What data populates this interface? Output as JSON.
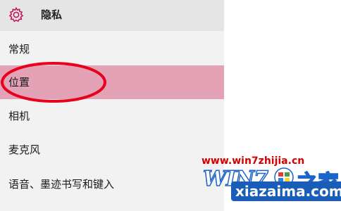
{
  "header": {
    "title": "隐私",
    "icon": "gear-icon"
  },
  "nav": {
    "items": [
      {
        "label": "常规",
        "selected": false
      },
      {
        "label": "位置",
        "selected": true
      },
      {
        "label": "相机",
        "selected": false
      },
      {
        "label": "麦克风",
        "selected": false
      },
      {
        "label": "语音、墨迹书写和键入",
        "selected": false
      }
    ]
  },
  "watermark": {
    "url": "www.win7zhijia.cn",
    "brand": "WIN7",
    "brand_char": "之家",
    "site": "xiazaima.com"
  },
  "colors": {
    "accent": "#e3a2b6",
    "highlight_circle": "#e8001c",
    "sidebar_bg": "#f2f2f2",
    "header_bg": "#e5e5e5"
  }
}
